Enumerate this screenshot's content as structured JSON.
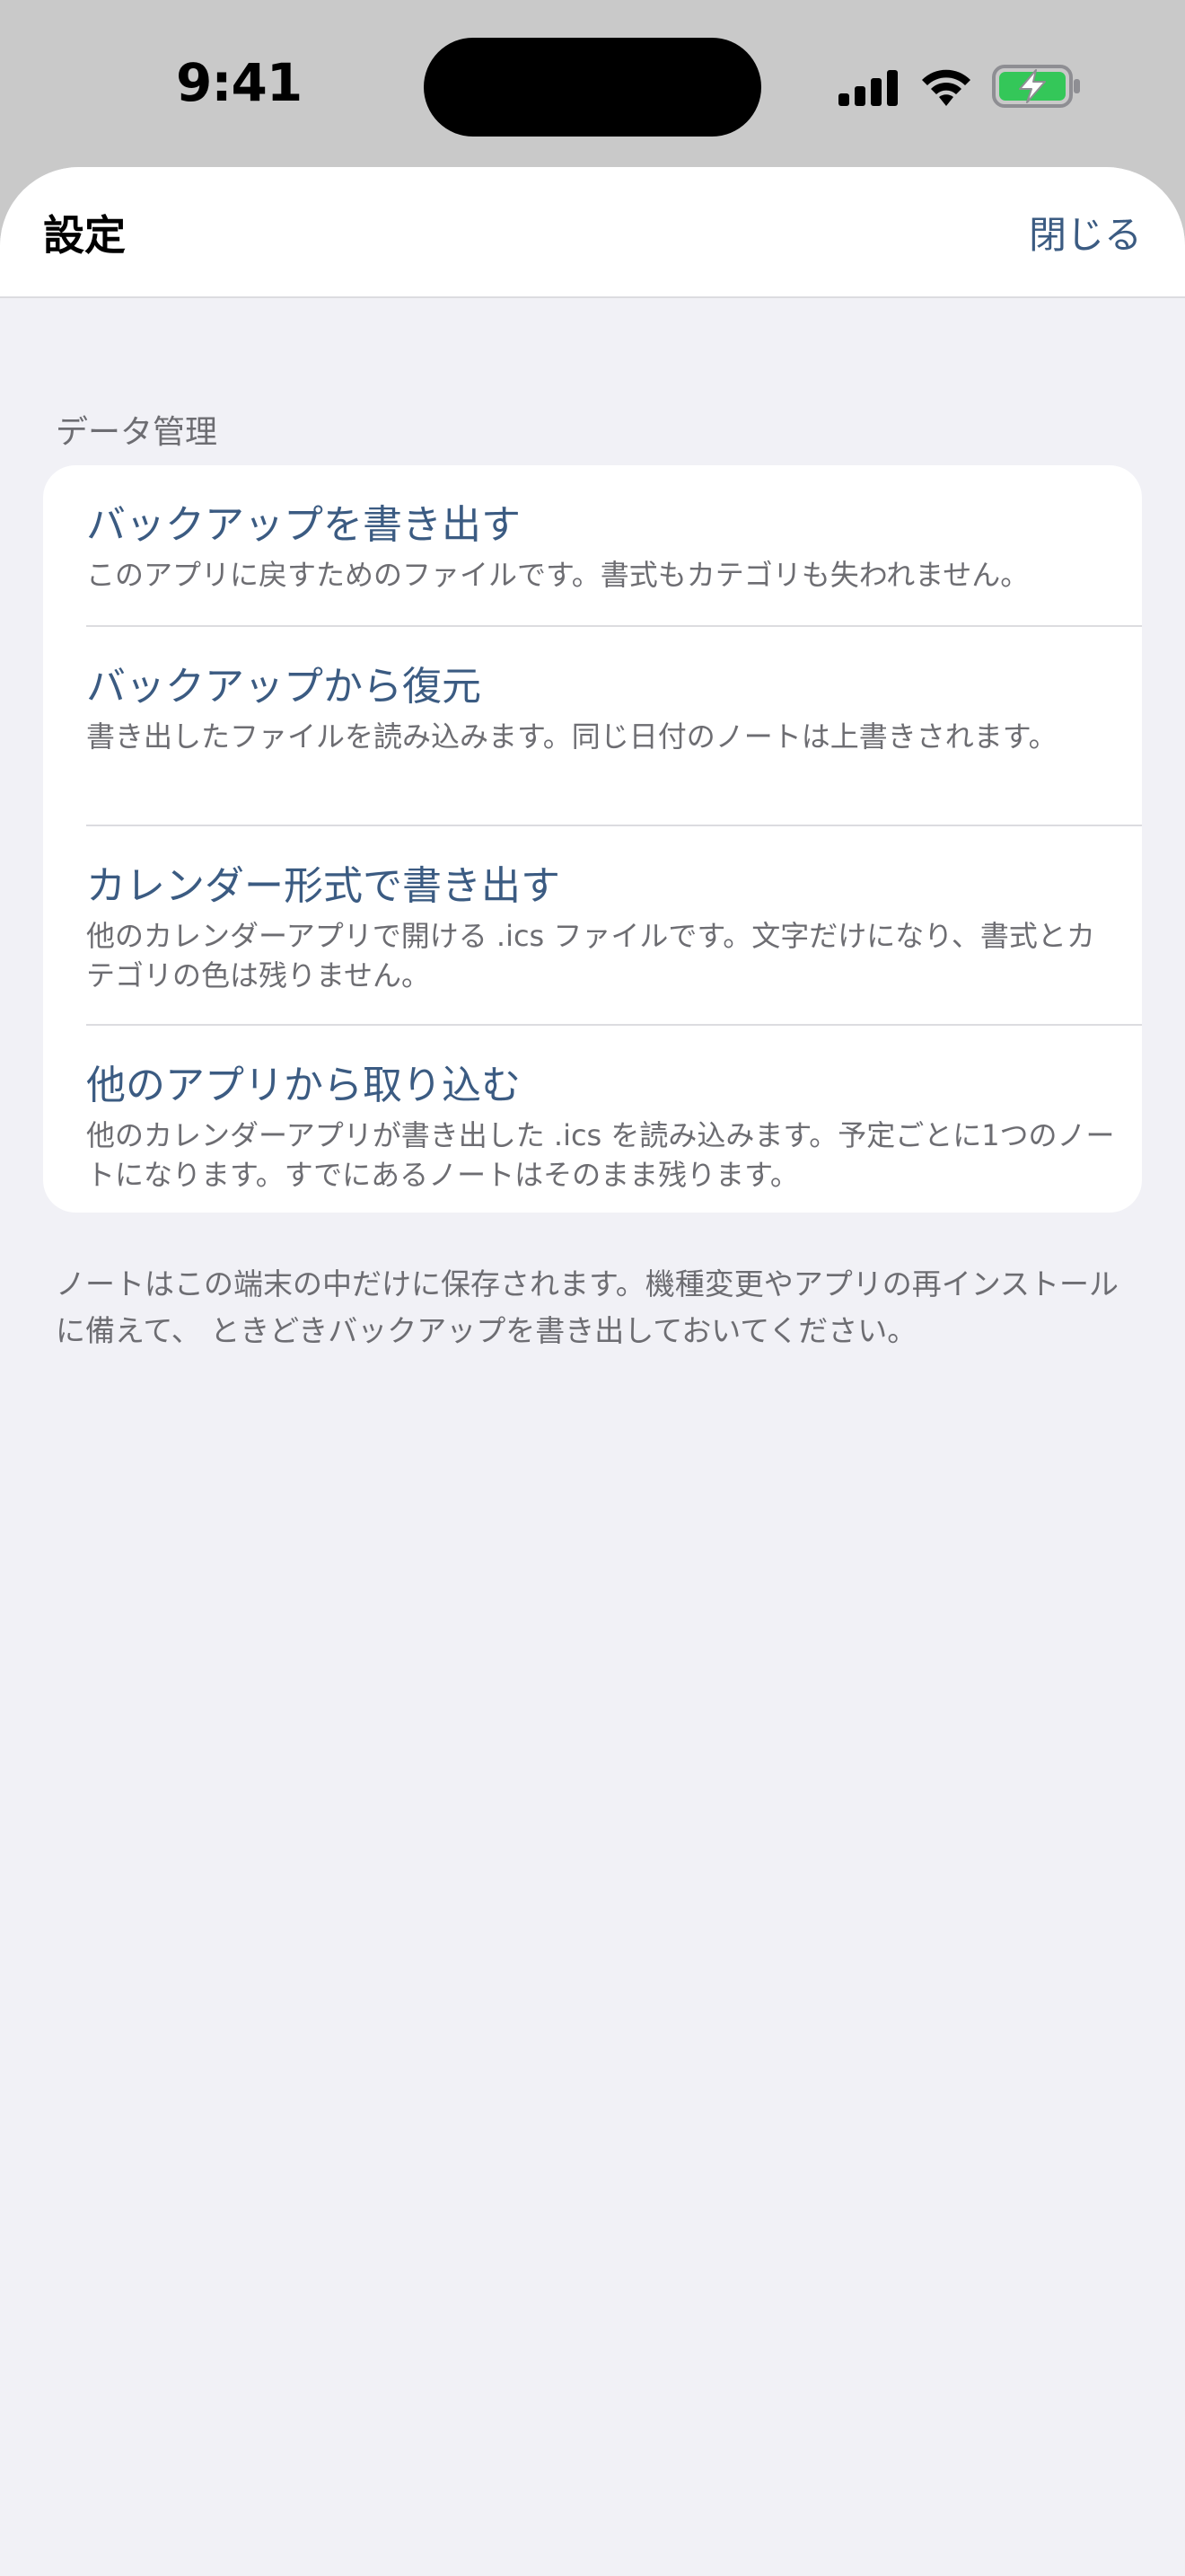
{
  "status_bar": {
    "time": "9:41",
    "battery_color": "#34c759"
  },
  "nav": {
    "title": "設定",
    "close_label": "閉じる"
  },
  "section": {
    "header": "データ管理",
    "rows": [
      {
        "title": "バックアップを書き出す",
        "description": "このアプリに戻すためのファイルです。書式もカテゴリも失われません。"
      },
      {
        "title": "バックアップから復元",
        "description": "書き出したファイルを読み込みます。同じ日付のノートは上書きされます。"
      },
      {
        "title": "カレンダー形式で書き出す",
        "description": "他のカレンダーアプリで開ける .ics ファイルです。文字だけになり、書式とカテゴリの色は残りません。"
      },
      {
        "title": "他のアプリから取り込む",
        "description": "他のカレンダーアプリが書き出した .ics を読み込みます。予定ごとに1つのノートになります。すでにあるノートはそのまま残ります。"
      }
    ],
    "footer": "ノートはこの端末の中だけに保存されます。機種変更やアプリの再インストールに備えて、 ときどきバックアップを書き出しておいてください。"
  },
  "colors": {
    "accent": "#3b5b82",
    "background": "#f1f1f6",
    "secondary_text": "#6d6d72"
  }
}
